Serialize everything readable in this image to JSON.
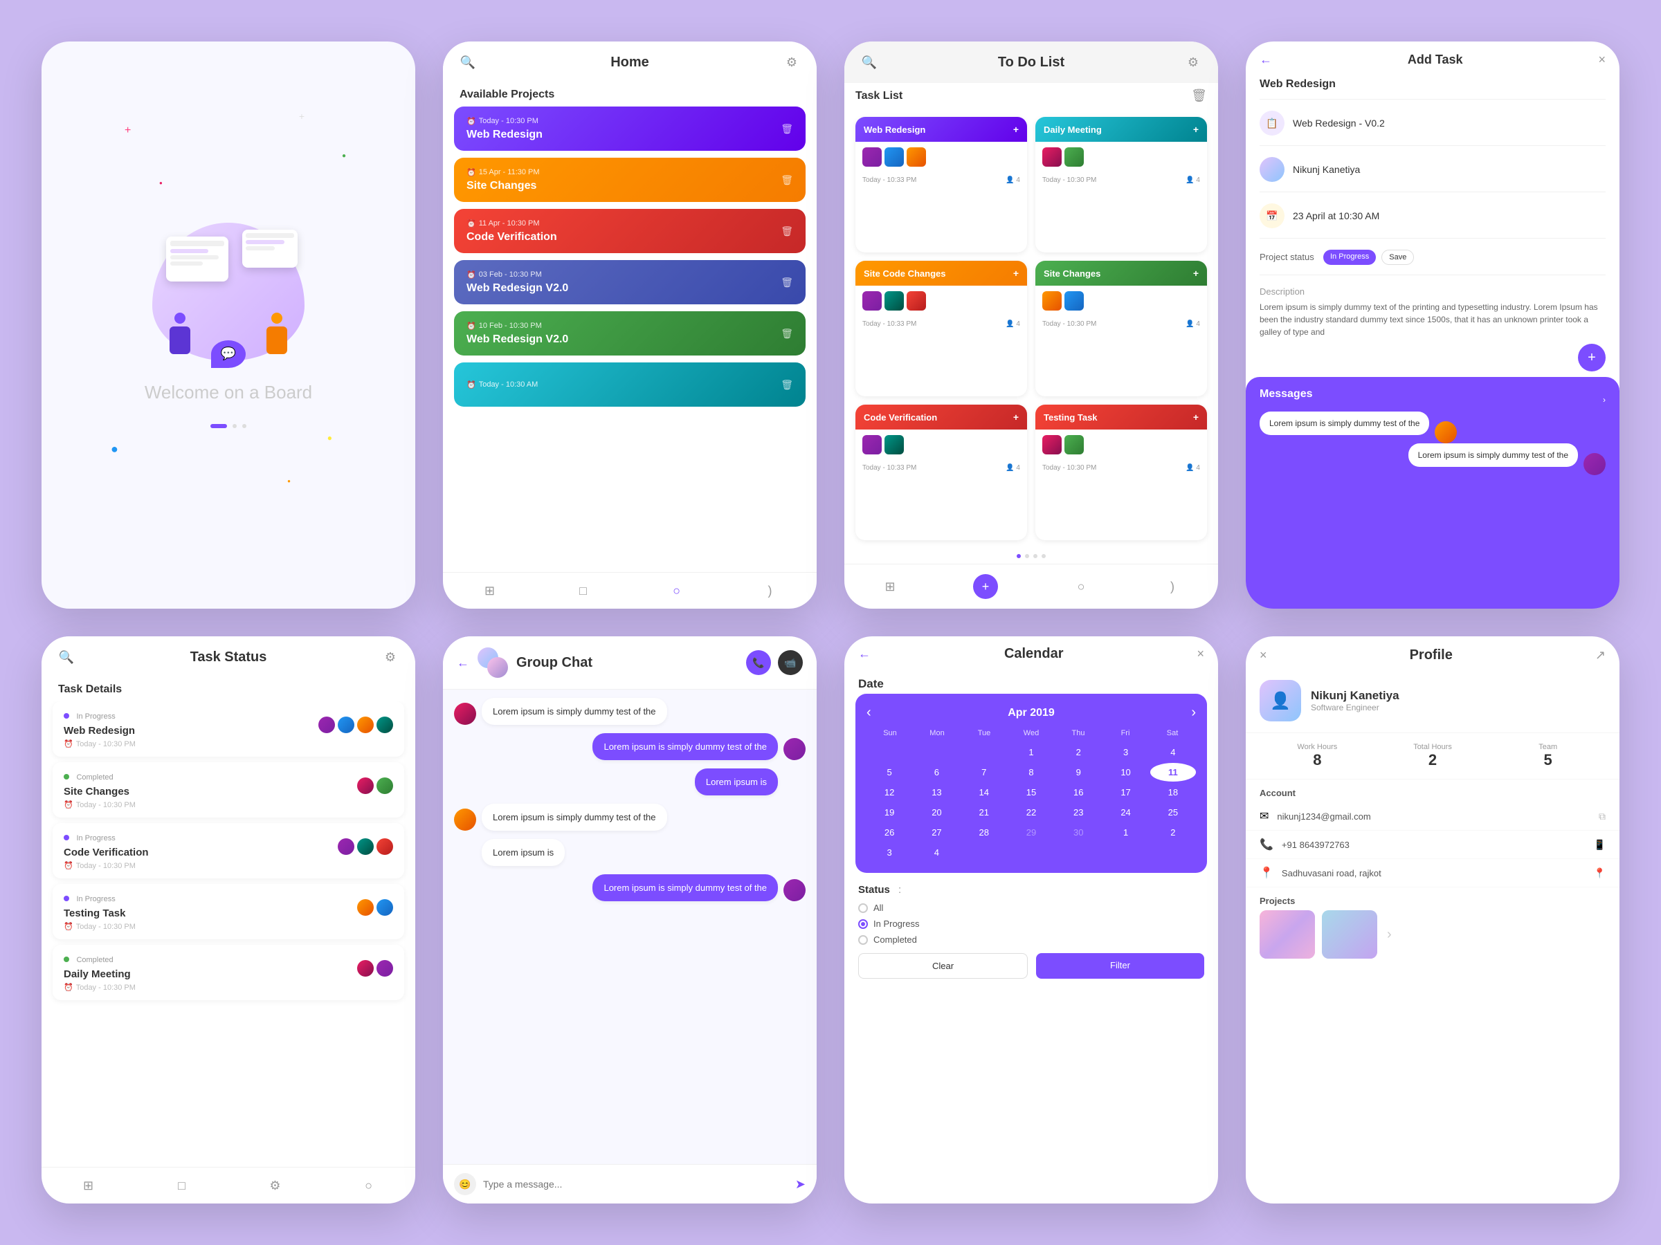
{
  "bg": {
    "color": "#c9b8f0"
  },
  "screens": [
    {
      "id": "welcome",
      "welcome_text": "Welcome on a Board"
    },
    {
      "id": "home",
      "title": "Home",
      "section": "Available Projects",
      "projects": [
        {
          "name": "Web Redesign",
          "time": "Today - 10:30 PM",
          "color": "card-purple"
        },
        {
          "name": "Site Changes",
          "time": "15 Apr - 11:30 PM",
          "color": "card-orange"
        },
        {
          "name": "Code Verification",
          "time": "11 Apr - 10:30 PM",
          "color": "card-red"
        },
        {
          "name": "Web Redesign V2.0",
          "time": "03 Feb - 10:30 PM",
          "color": "card-indigo"
        },
        {
          "name": "Web Redesign V2.0",
          "time": "10 Feb - 10:30 PM",
          "color": "card-green"
        },
        {
          "name": "",
          "time": "Today - 10:30 AM",
          "color": "card-teal"
        }
      ]
    },
    {
      "id": "todo",
      "title": "To Do List",
      "section": "Task List",
      "cards": [
        {
          "name": "Web Redesign",
          "color": "card-purple",
          "time": "Today - 10:33 PM"
        },
        {
          "name": "Daily Meeting",
          "color": "card-teal",
          "time": "Today - 10:30 PM"
        },
        {
          "name": "Site Code Changes",
          "color": "card-orange",
          "time": "Today - 10:33 PM"
        },
        {
          "name": "Site Changes",
          "color": "card-green",
          "time": "Today - 10:30 PM"
        },
        {
          "name": "Code Verification",
          "color": "card-red",
          "time": "Today - 10:33 PM"
        },
        {
          "name": "Testing Task",
          "color": "card-red",
          "time": "Today - 10:30 PM"
        }
      ]
    },
    {
      "id": "addtask",
      "title": "Add Task",
      "task_name": "Web Redesign",
      "version": "Web Redesign - V0.2",
      "assignee": "Nikunj Kanetiya",
      "date": "23 April at 10:30 AM",
      "status": "In Progress",
      "description": "Lorem ipsum is simply dummy text of the printing and typesetting industry. Lorem Ipsum has been the industry standard dummy text since 1500s, that it has an unknown printer took a galley of type and",
      "messages_title": "Messages",
      "message1": "Lorem ipsum is simply dummy test of the",
      "message2": "Lorem ipsum is simply dummy test of the"
    },
    {
      "id": "taskstatus",
      "title": "Task Status",
      "section": "Task Details",
      "tasks": [
        {
          "status": "In Progress",
          "name": "Web Redesign",
          "time": "Today - 10:30 PM",
          "status_color": "#7c4dff"
        },
        {
          "status": "Completed",
          "name": "Site Changes",
          "time": "Today - 10:30 PM",
          "status_color": "#4caf50"
        },
        {
          "status": "In Progress",
          "name": "Code Verification",
          "time": "Today - 10:30 PM",
          "status_color": "#7c4dff"
        },
        {
          "status": "In Progress",
          "name": "Testing Task",
          "time": "Today - 10:30 PM",
          "status_color": "#7c4dff"
        },
        {
          "status": "Completed",
          "name": "Daily Meeting",
          "time": "Today - 10:30 PM",
          "status_color": "#4caf50"
        }
      ]
    },
    {
      "id": "groupchat",
      "title": "Group Chat",
      "messages": [
        {
          "text": "Lorem ipsum is simply dummy test of the",
          "sent": false
        },
        {
          "text": "Lorem ipsum is simply dummy test of the",
          "sent": true
        },
        {
          "text": "Lorem ipsum is",
          "sent": true
        },
        {
          "text": "Lorem ipsum is simply dummy test of the",
          "sent": false
        },
        {
          "text": "Lorem ipsum is",
          "sent": false
        },
        {
          "text": "Lorem ipsum is simply dummy test of the",
          "sent": true
        }
      ],
      "placeholder": "Type a message..."
    },
    {
      "id": "calendar",
      "title": "Calendar",
      "date_label": "Date",
      "month": "Apr 2019",
      "days": [
        "Sun",
        "Mon",
        "Tue",
        "Wed",
        "Thu",
        "Fri",
        "Sat"
      ],
      "weeks": [
        [
          "",
          "",
          "",
          "1",
          "2",
          "3",
          "4"
        ],
        [
          "5",
          "6",
          "7",
          "8",
          "9",
          "10",
          "11"
        ],
        [
          "12",
          "13",
          "14",
          "15",
          "16",
          "17",
          "18"
        ],
        [
          "19",
          "20",
          "21",
          "22",
          "23",
          "24",
          "25"
        ],
        [
          "26",
          "27",
          "28",
          "29",
          "30",
          "1",
          "2"
        ],
        [
          "3",
          "4",
          "",
          "",
          "",
          "",
          ""
        ]
      ],
      "today": "11",
      "status_label": "Status",
      "status_options": [
        "All",
        "In Progress",
        "Completed"
      ],
      "selected_status": "In Progress",
      "btn_clear": "Clear",
      "btn_filter": "Filter"
    },
    {
      "id": "profile",
      "title": "Profile",
      "name": "Nikunj Kanetiya",
      "role": "Software Engineer",
      "stats": [
        {
          "label": "Work Hours",
          "value": "8"
        },
        {
          "label": "Total Hours",
          "value": "2"
        },
        {
          "label": "Team",
          "value": "5"
        }
      ],
      "account_label": "Account",
      "email": "nikunj1234@gmail.com",
      "phone": "+91 8643972763",
      "address": "Sadhuvasani road, rajkot",
      "projects_label": "Projects"
    }
  ]
}
